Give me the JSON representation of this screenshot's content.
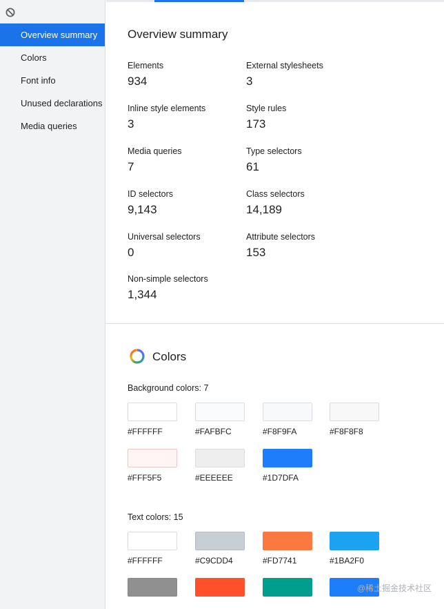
{
  "sidebar": {
    "items": [
      {
        "label": "Overview summary",
        "active": true
      },
      {
        "label": "Colors",
        "active": false
      },
      {
        "label": "Font info",
        "active": false
      },
      {
        "label": "Unused declarations",
        "active": false
      },
      {
        "label": "Media queries",
        "active": false
      }
    ]
  },
  "overview": {
    "title": "Overview summary",
    "stats": [
      {
        "label": "Elements",
        "value": "934"
      },
      {
        "label": "External stylesheets",
        "value": "3"
      },
      {
        "label": "Inline style elements",
        "value": "3"
      },
      {
        "label": "Style rules",
        "value": "173"
      },
      {
        "label": "Media queries",
        "value": "7"
      },
      {
        "label": "Type selectors",
        "value": "61"
      },
      {
        "label": "ID selectors",
        "value": "9,143"
      },
      {
        "label": "Class selectors",
        "value": "14,189"
      },
      {
        "label": "Universal selectors",
        "value": "0"
      },
      {
        "label": "Attribute selectors",
        "value": "153"
      },
      {
        "label": "Non-simple selectors",
        "value": "1,344"
      }
    ]
  },
  "colors": {
    "title": "Colors",
    "background_label": "Background colors: 7",
    "background": [
      {
        "code": "#FFFFFF",
        "hex": "#FFFFFF"
      },
      {
        "code": "#FAFBFC",
        "hex": "#FAFBFC"
      },
      {
        "code": "#F8F9FA",
        "hex": "#F8F9FA"
      },
      {
        "code": "#F8F8F8",
        "hex": "#F8F8F8"
      },
      {
        "code": "#FFF5F5",
        "hex": "#FFF5F5"
      },
      {
        "code": "#EEEEEE",
        "hex": "#EEEEEE"
      },
      {
        "code": "#1D7DFA",
        "hex": "#1D7DFA"
      }
    ],
    "text_label": "Text colors: 15",
    "text": [
      {
        "code": "#FFFFFF",
        "hex": "#FFFFFF"
      },
      {
        "code": "#C9CDD4",
        "hex": "#C9CDD4"
      },
      {
        "code": "#FD7741",
        "hex": "#FD7741"
      },
      {
        "code": "#1BA2F0",
        "hex": "#1BA2F0"
      },
      {
        "code": "",
        "hex": "#909090"
      },
      {
        "code": "",
        "hex": "#FF502C"
      },
      {
        "code": "",
        "hex": "#009E8D"
      },
      {
        "code": "",
        "hex": "#1D7DFA"
      }
    ]
  },
  "watermark": "@稀土掘金技术社区",
  "theme": {
    "accent": "#1a73e8",
    "sidebar_bg": "#f1f3f4"
  }
}
